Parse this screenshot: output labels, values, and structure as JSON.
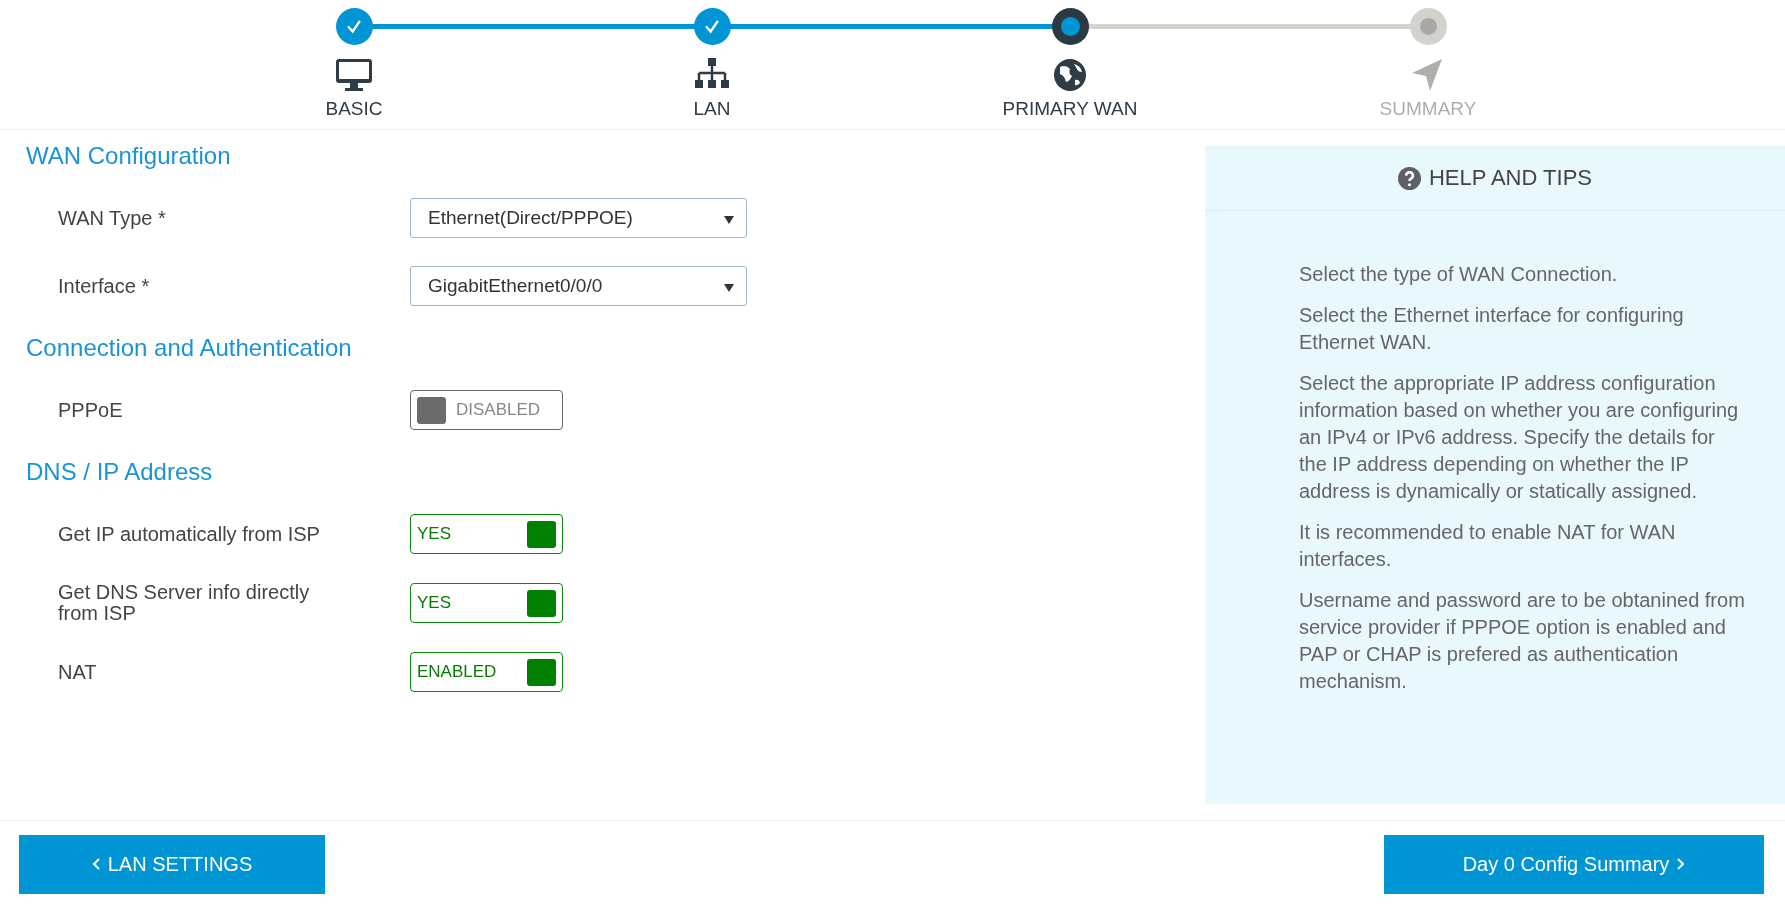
{
  "steps": [
    {
      "label": "BASIC",
      "done": true,
      "selected": false
    },
    {
      "label": "LAN",
      "done": true,
      "selected": false
    },
    {
      "label": "PRIMARY WAN",
      "done": false,
      "selected": true
    },
    {
      "label": "SUMMARY",
      "done": false,
      "selected": false
    }
  ],
  "sections": [
    {
      "title": "WAN Configuration",
      "fields": [
        {
          "kind": "select",
          "label": "WAN Type *",
          "value": "Ethernet(Direct/PPPOE)"
        },
        {
          "kind": "select",
          "label": "Interface *",
          "value": "GigabitEthernet0/0/0"
        }
      ]
    },
    {
      "title": "Connection and Authentication",
      "fields": [
        {
          "kind": "toggle",
          "label": "PPPoE",
          "value": "DISABLED",
          "on": false
        }
      ]
    },
    {
      "title": "DNS / IP Address",
      "fields": [
        {
          "kind": "toggle",
          "label": "Get IP automatically from ISP",
          "value": "YES",
          "on": true
        },
        {
          "kind": "toggle",
          "label": "Get DNS Server info directly from ISP",
          "value": "YES",
          "on": true
        },
        {
          "kind": "toggle",
          "label": "NAT",
          "value": "ENABLED",
          "on": true
        }
      ]
    }
  ],
  "help": {
    "title": "HELP AND TIPS",
    "tips": [
      "Select the type of WAN Connection.",
      "Select the Ethernet interface for configuring Ethernet WAN.",
      "Select the appropriate IP address configuration information based on whether you are configuring an IPv4 or IPv6 address. Specify the details for the IP address depending on whether the IP address is dynamically or statically assigned.",
      "It is recommended to enable NAT for WAN interfaces.",
      "Username and password are to be obtanined from service provider if PPPOE option is enabled and PAP or CHAP is prefered as authentication mechanism."
    ]
  },
  "footer": {
    "back": "LAN SETTINGS",
    "next": "Day 0 Config Summary"
  }
}
